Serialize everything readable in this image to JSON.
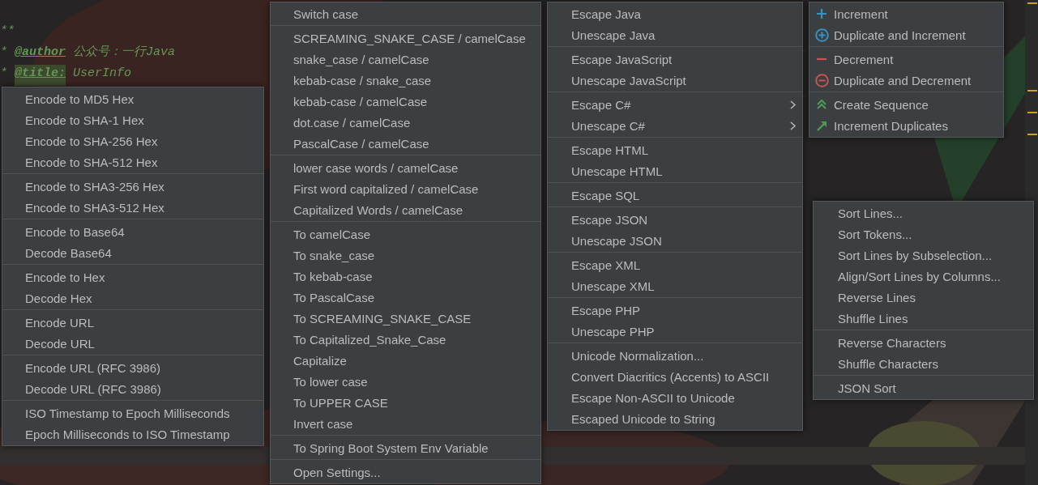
{
  "editor": {
    "lines": [
      {
        "text": "**"
      },
      {
        "prefix": "* ",
        "tag": "@author",
        "tag_highlighted": false,
        "text": " 公众号：一行Java"
      },
      {
        "prefix": "* ",
        "tag": "@title:",
        "tag_highlighted": true,
        "text": " UserInfo"
      }
    ]
  },
  "menus": [
    {
      "groups": [
        [
          {
            "label": "Encode to MD5 Hex"
          },
          {
            "label": "Encode to SHA-1 Hex"
          },
          {
            "label": "Encode to SHA-256 Hex"
          },
          {
            "label": "Encode to SHA-512 Hex"
          }
        ],
        [
          {
            "label": "Encode to SHA3-256 Hex"
          },
          {
            "label": "Encode to SHA3-512 Hex"
          }
        ],
        [
          {
            "label": "Encode to Base64"
          },
          {
            "label": "Decode Base64"
          }
        ],
        [
          {
            "label": "Encode to Hex"
          },
          {
            "label": "Decode Hex"
          }
        ],
        [
          {
            "label": "Encode URL"
          },
          {
            "label": "Decode URL"
          }
        ],
        [
          {
            "label": "Encode URL (RFC 3986)"
          },
          {
            "label": "Decode URL (RFC 3986)"
          }
        ],
        [
          {
            "label": "ISO Timestamp to Epoch Milliseconds"
          },
          {
            "label": "Epoch Milliseconds to ISO Timestamp"
          }
        ]
      ]
    },
    {
      "groups": [
        [
          {
            "label": "Switch case"
          }
        ],
        [
          {
            "label": "SCREAMING_SNAKE_CASE / camelCase"
          },
          {
            "label": "snake_case / camelCase"
          },
          {
            "label": "kebab-case / snake_case"
          },
          {
            "label": "kebab-case / camelCase"
          },
          {
            "label": "dot.case / camelCase"
          },
          {
            "label": "PascalCase / camelCase"
          }
        ],
        [
          {
            "label": "lower case words / camelCase"
          },
          {
            "label": "First word capitalized / camelCase"
          },
          {
            "label": "Capitalized Words / camelCase"
          }
        ],
        [
          {
            "label": "To camelCase"
          },
          {
            "label": "To snake_case"
          },
          {
            "label": "To kebab-case"
          },
          {
            "label": "To PascalCase"
          },
          {
            "label": "To SCREAMING_SNAKE_CASE"
          },
          {
            "label": "To Capitalized_Snake_Case"
          },
          {
            "label": "Capitalize"
          },
          {
            "label": "To lower case"
          },
          {
            "label": "To UPPER CASE"
          },
          {
            "label": "Invert case"
          }
        ],
        [
          {
            "label": "To Spring Boot System Env Variable"
          }
        ],
        [
          {
            "label": "Open Settings..."
          }
        ]
      ]
    },
    {
      "groups": [
        [
          {
            "label": "Escape Java"
          },
          {
            "label": "Unescape Java"
          }
        ],
        [
          {
            "label": "Escape JavaScript"
          },
          {
            "label": "Unescape JavaScript"
          }
        ],
        [
          {
            "label": "Escape C#",
            "submenu": true
          },
          {
            "label": "Unescape C#",
            "submenu": true
          }
        ],
        [
          {
            "label": "Escape HTML"
          },
          {
            "label": "Unescape HTML"
          }
        ],
        [
          {
            "label": "Escape SQL"
          }
        ],
        [
          {
            "label": "Escape JSON"
          },
          {
            "label": "Unescape JSON"
          }
        ],
        [
          {
            "label": "Escape XML"
          },
          {
            "label": "Unescape XML"
          }
        ],
        [
          {
            "label": "Escape PHP"
          },
          {
            "label": "Unescape PHP"
          }
        ],
        [
          {
            "label": "Unicode Normalization..."
          },
          {
            "label": "Convert Diacritics (Accents) to ASCII"
          },
          {
            "label": "Escape Non-ASCII to Unicode"
          },
          {
            "label": "Escaped Unicode to String"
          }
        ]
      ]
    },
    {
      "groups": [
        [
          {
            "label": "Increment",
            "kind": "plus"
          },
          {
            "label": "Duplicate and Increment",
            "kind": "pluscircle"
          }
        ],
        [
          {
            "label": "Decrement",
            "kind": "minus"
          },
          {
            "label": "Duplicate and Decrement",
            "kind": "minuscircle"
          }
        ],
        [
          {
            "label": "Create Sequence",
            "kind": "chevrons"
          },
          {
            "label": "Increment Duplicates",
            "kind": "arrow"
          }
        ]
      ]
    },
    {
      "groups": [
        [
          {
            "label": "Sort Lines..."
          },
          {
            "label": "Sort Tokens..."
          },
          {
            "label": "Sort Lines by Subselection..."
          },
          {
            "label": "Align/Sort Lines by Columns..."
          },
          {
            "label": "Reverse Lines"
          },
          {
            "label": "Shuffle Lines"
          }
        ],
        [
          {
            "label": "Reverse Characters"
          },
          {
            "label": "Shuffle Characters"
          }
        ],
        [
          {
            "label": "JSON Sort"
          }
        ]
      ]
    }
  ]
}
